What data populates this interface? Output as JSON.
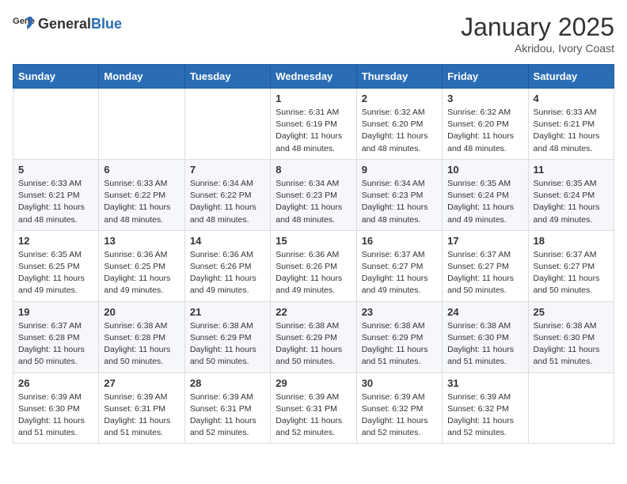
{
  "header": {
    "logo_general": "General",
    "logo_blue": "Blue",
    "month_title": "January 2025",
    "location": "Akridou, Ivory Coast"
  },
  "days_of_week": [
    "Sunday",
    "Monday",
    "Tuesday",
    "Wednesday",
    "Thursday",
    "Friday",
    "Saturday"
  ],
  "weeks": [
    [
      {
        "day": "",
        "sunrise": "",
        "sunset": "",
        "daylight": ""
      },
      {
        "day": "",
        "sunrise": "",
        "sunset": "",
        "daylight": ""
      },
      {
        "day": "",
        "sunrise": "",
        "sunset": "",
        "daylight": ""
      },
      {
        "day": "1",
        "sunrise": "Sunrise: 6:31 AM",
        "sunset": "Sunset: 6:19 PM",
        "daylight": "Daylight: 11 hours and 48 minutes."
      },
      {
        "day": "2",
        "sunrise": "Sunrise: 6:32 AM",
        "sunset": "Sunset: 6:20 PM",
        "daylight": "Daylight: 11 hours and 48 minutes."
      },
      {
        "day": "3",
        "sunrise": "Sunrise: 6:32 AM",
        "sunset": "Sunset: 6:20 PM",
        "daylight": "Daylight: 11 hours and 48 minutes."
      },
      {
        "day": "4",
        "sunrise": "Sunrise: 6:33 AM",
        "sunset": "Sunset: 6:21 PM",
        "daylight": "Daylight: 11 hours and 48 minutes."
      }
    ],
    [
      {
        "day": "5",
        "sunrise": "Sunrise: 6:33 AM",
        "sunset": "Sunset: 6:21 PM",
        "daylight": "Daylight: 11 hours and 48 minutes."
      },
      {
        "day": "6",
        "sunrise": "Sunrise: 6:33 AM",
        "sunset": "Sunset: 6:22 PM",
        "daylight": "Daylight: 11 hours and 48 minutes."
      },
      {
        "day": "7",
        "sunrise": "Sunrise: 6:34 AM",
        "sunset": "Sunset: 6:22 PM",
        "daylight": "Daylight: 11 hours and 48 minutes."
      },
      {
        "day": "8",
        "sunrise": "Sunrise: 6:34 AM",
        "sunset": "Sunset: 6:23 PM",
        "daylight": "Daylight: 11 hours and 48 minutes."
      },
      {
        "day": "9",
        "sunrise": "Sunrise: 6:34 AM",
        "sunset": "Sunset: 6:23 PM",
        "daylight": "Daylight: 11 hours and 48 minutes."
      },
      {
        "day": "10",
        "sunrise": "Sunrise: 6:35 AM",
        "sunset": "Sunset: 6:24 PM",
        "daylight": "Daylight: 11 hours and 49 minutes."
      },
      {
        "day": "11",
        "sunrise": "Sunrise: 6:35 AM",
        "sunset": "Sunset: 6:24 PM",
        "daylight": "Daylight: 11 hours and 49 minutes."
      }
    ],
    [
      {
        "day": "12",
        "sunrise": "Sunrise: 6:35 AM",
        "sunset": "Sunset: 6:25 PM",
        "daylight": "Daylight: 11 hours and 49 minutes."
      },
      {
        "day": "13",
        "sunrise": "Sunrise: 6:36 AM",
        "sunset": "Sunset: 6:25 PM",
        "daylight": "Daylight: 11 hours and 49 minutes."
      },
      {
        "day": "14",
        "sunrise": "Sunrise: 6:36 AM",
        "sunset": "Sunset: 6:26 PM",
        "daylight": "Daylight: 11 hours and 49 minutes."
      },
      {
        "day": "15",
        "sunrise": "Sunrise: 6:36 AM",
        "sunset": "Sunset: 6:26 PM",
        "daylight": "Daylight: 11 hours and 49 minutes."
      },
      {
        "day": "16",
        "sunrise": "Sunrise: 6:37 AM",
        "sunset": "Sunset: 6:27 PM",
        "daylight": "Daylight: 11 hours and 49 minutes."
      },
      {
        "day": "17",
        "sunrise": "Sunrise: 6:37 AM",
        "sunset": "Sunset: 6:27 PM",
        "daylight": "Daylight: 11 hours and 50 minutes."
      },
      {
        "day": "18",
        "sunrise": "Sunrise: 6:37 AM",
        "sunset": "Sunset: 6:27 PM",
        "daylight": "Daylight: 11 hours and 50 minutes."
      }
    ],
    [
      {
        "day": "19",
        "sunrise": "Sunrise: 6:37 AM",
        "sunset": "Sunset: 6:28 PM",
        "daylight": "Daylight: 11 hours and 50 minutes."
      },
      {
        "day": "20",
        "sunrise": "Sunrise: 6:38 AM",
        "sunset": "Sunset: 6:28 PM",
        "daylight": "Daylight: 11 hours and 50 minutes."
      },
      {
        "day": "21",
        "sunrise": "Sunrise: 6:38 AM",
        "sunset": "Sunset: 6:29 PM",
        "daylight": "Daylight: 11 hours and 50 minutes."
      },
      {
        "day": "22",
        "sunrise": "Sunrise: 6:38 AM",
        "sunset": "Sunset: 6:29 PM",
        "daylight": "Daylight: 11 hours and 50 minutes."
      },
      {
        "day": "23",
        "sunrise": "Sunrise: 6:38 AM",
        "sunset": "Sunset: 6:29 PM",
        "daylight": "Daylight: 11 hours and 51 minutes."
      },
      {
        "day": "24",
        "sunrise": "Sunrise: 6:38 AM",
        "sunset": "Sunset: 6:30 PM",
        "daylight": "Daylight: 11 hours and 51 minutes."
      },
      {
        "day": "25",
        "sunrise": "Sunrise: 6:38 AM",
        "sunset": "Sunset: 6:30 PM",
        "daylight": "Daylight: 11 hours and 51 minutes."
      }
    ],
    [
      {
        "day": "26",
        "sunrise": "Sunrise: 6:39 AM",
        "sunset": "Sunset: 6:30 PM",
        "daylight": "Daylight: 11 hours and 51 minutes."
      },
      {
        "day": "27",
        "sunrise": "Sunrise: 6:39 AM",
        "sunset": "Sunset: 6:31 PM",
        "daylight": "Daylight: 11 hours and 51 minutes."
      },
      {
        "day": "28",
        "sunrise": "Sunrise: 6:39 AM",
        "sunset": "Sunset: 6:31 PM",
        "daylight": "Daylight: 11 hours and 52 minutes."
      },
      {
        "day": "29",
        "sunrise": "Sunrise: 6:39 AM",
        "sunset": "Sunset: 6:31 PM",
        "daylight": "Daylight: 11 hours and 52 minutes."
      },
      {
        "day": "30",
        "sunrise": "Sunrise: 6:39 AM",
        "sunset": "Sunset: 6:32 PM",
        "daylight": "Daylight: 11 hours and 52 minutes."
      },
      {
        "day": "31",
        "sunrise": "Sunrise: 6:39 AM",
        "sunset": "Sunset: 6:32 PM",
        "daylight": "Daylight: 11 hours and 52 minutes."
      },
      {
        "day": "",
        "sunrise": "",
        "sunset": "",
        "daylight": ""
      }
    ]
  ]
}
